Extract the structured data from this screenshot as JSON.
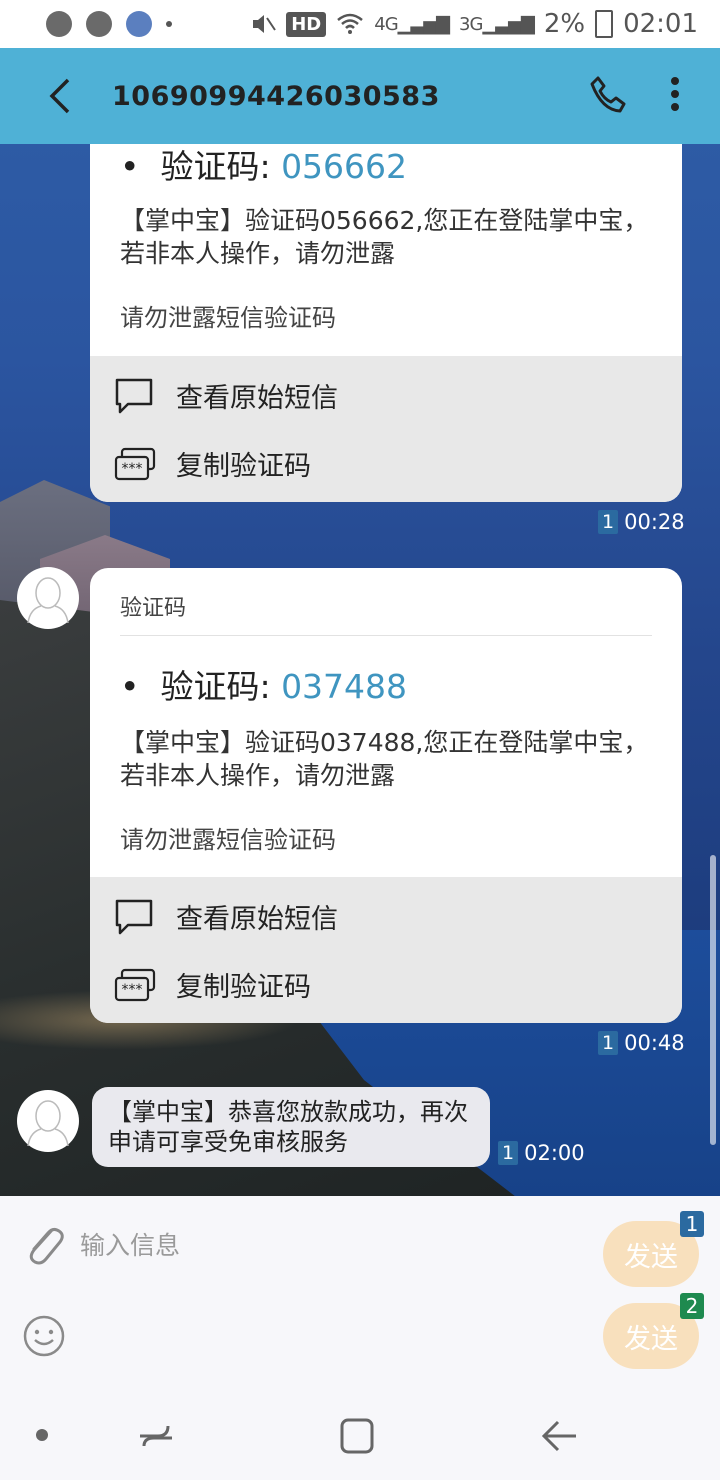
{
  "status_bar": {
    "network": "HD",
    "signal_4g": "4G",
    "signal_3g": "3G",
    "battery": "2%",
    "time": "02:01"
  },
  "app_bar": {
    "title": "10690994426030583"
  },
  "messages": [
    {
      "code_label": "验证码: ",
      "code": "056662",
      "body": "【掌中宝】验证码056662,您正在登陆掌中宝，若非本人操作，请勿泄露",
      "hint": "请勿泄露短信验证码",
      "action_view": "查看原始短信",
      "action_copy": "复制验证码",
      "sim": "1",
      "time": "00:28"
    },
    {
      "header": "验证码",
      "code_label": "验证码: ",
      "code": "037488",
      "body": "【掌中宝】验证码037488,您正在登陆掌中宝，若非本人操作，请勿泄露",
      "hint": "请勿泄露短信验证码",
      "action_view": "查看原始短信",
      "action_copy": "复制验证码",
      "sim": "1",
      "time": "00:48"
    },
    {
      "body": "【掌中宝】恭喜您放款成功，再次申请可享受免审核服务",
      "sim": "1",
      "time": "02:00"
    }
  ],
  "input": {
    "placeholder": "输入信息",
    "send_sim1_label": "发送",
    "send_sim2_label": "发送",
    "sim1": "1",
    "sim2": "2"
  },
  "colors": {
    "app_bar": "#4fb1d6",
    "code": "#3f95c0",
    "send_button": "#f8e0bd",
    "sim1_badge": "#2b6aa0",
    "sim2_badge": "#1e8a4f"
  }
}
